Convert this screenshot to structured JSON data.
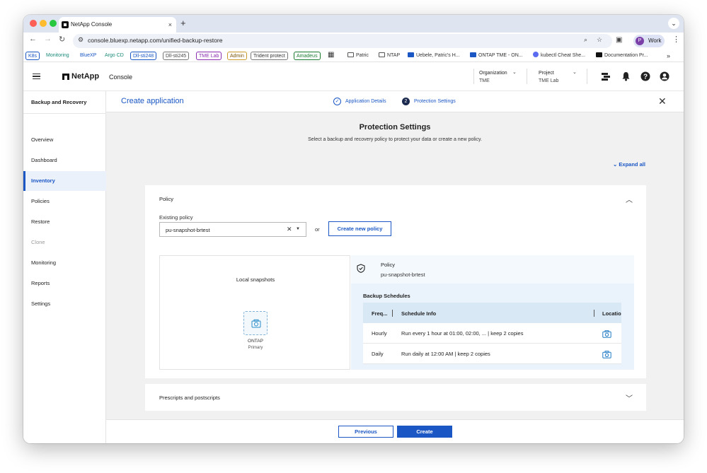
{
  "browser": {
    "tab_title": "NetApp Console",
    "tab_close": "×",
    "new_tab": "+",
    "url": "console.bluexp.netapp.com/unified-backup-restore",
    "profile_initial": "P",
    "profile_label": "Work",
    "bookmarks_pills": [
      {
        "label": "K8s",
        "color": "#1a56c4"
      },
      {
        "label": "Monitoring",
        "color": "#1a8a7a"
      },
      {
        "label": "BlueXP",
        "color": "#1a56c4"
      },
      {
        "label": "Argo CD",
        "color": "#1a8a7a"
      },
      {
        "label": "Dll-sti248",
        "color": "#1a56c4"
      },
      {
        "label": "Dll-sti245",
        "color": "#555555"
      },
      {
        "label": "TME Lab",
        "color": "#8a2bb0"
      },
      {
        "label": "Admin",
        "color": "#a06a00"
      },
      {
        "label": "Trident protect",
        "color": "#333333"
      },
      {
        "label": "Amadeus",
        "color": "#1a7a30"
      }
    ],
    "bookmarks_plain": [
      "Patric",
      "NTAP",
      "Uebele, Patric's H...",
      "ONTAP TME - ON...",
      "kubectl Cheat She...",
      "Documentation Pr..."
    ],
    "bookmarks_overflow": "»"
  },
  "header": {
    "brand": "NetApp",
    "product": "Console",
    "organization_label": "Organization",
    "organization_value": "TME",
    "project_label": "Project",
    "project_value": "TME Lab",
    "caret": "⌄",
    "icons": [
      "workloads-icon",
      "bell-icon",
      "help-icon",
      "user-icon"
    ]
  },
  "sidebar": {
    "title": "Backup and Recovery",
    "items": [
      {
        "label": "Overview",
        "state": "normal"
      },
      {
        "label": "Dashboard",
        "state": "normal"
      },
      {
        "label": "Inventory",
        "state": "active"
      },
      {
        "label": "Policies",
        "state": "normal"
      },
      {
        "label": "Restore",
        "state": "normal"
      },
      {
        "label": "Clone",
        "state": "disabled"
      },
      {
        "label": "Monitoring",
        "state": "normal"
      },
      {
        "label": "Reports",
        "state": "normal"
      },
      {
        "label": "Settings",
        "state": "normal"
      }
    ]
  },
  "page": {
    "title": "Create application",
    "step1_label": "Application Details",
    "step1_icon": "✓",
    "step2_number": "2",
    "step2_label": "Protection Settings",
    "close": "✕"
  },
  "protection": {
    "title": "Protection Settings",
    "subtitle": "Select a backup and recovery policy to protect your data or create a new policy.",
    "expand_all": "Expand all",
    "expand_icon": "⌄",
    "policy_card_title": "Policy",
    "collapse_icon": "︿",
    "existing_policy_label": "Existing policy",
    "existing_policy_value": "pu-snapshot-brtest",
    "clear_icon": "✕",
    "select_caret": "▼",
    "or": "or",
    "create_new_policy": "Create new policy",
    "local_snapshots": "Local snapshots",
    "ontap_label": "ONTAP",
    "primary_label": "Primary",
    "details_label": "Policy",
    "details_value": "pu-snapshot-brtest",
    "schedules_title": "Backup Schedules",
    "columns": [
      "Freq...",
      "Schedule Info",
      "Location"
    ],
    "rows": [
      {
        "frequency": "Hourly",
        "info": "Run every 1 hour at 01:00, 02:00, ... | keep 2 copies"
      },
      {
        "frequency": "Daily",
        "info": "Run daily at 12:00 AM | keep 2 copies"
      }
    ],
    "scripts_title": "Prescripts and postscripts",
    "scripts_icon": "﹀"
  },
  "footer": {
    "previous": "Previous",
    "create": "Create"
  },
  "colors": {
    "accent": "#1a56c4",
    "nav_active_bg": "#eaf1fb"
  }
}
